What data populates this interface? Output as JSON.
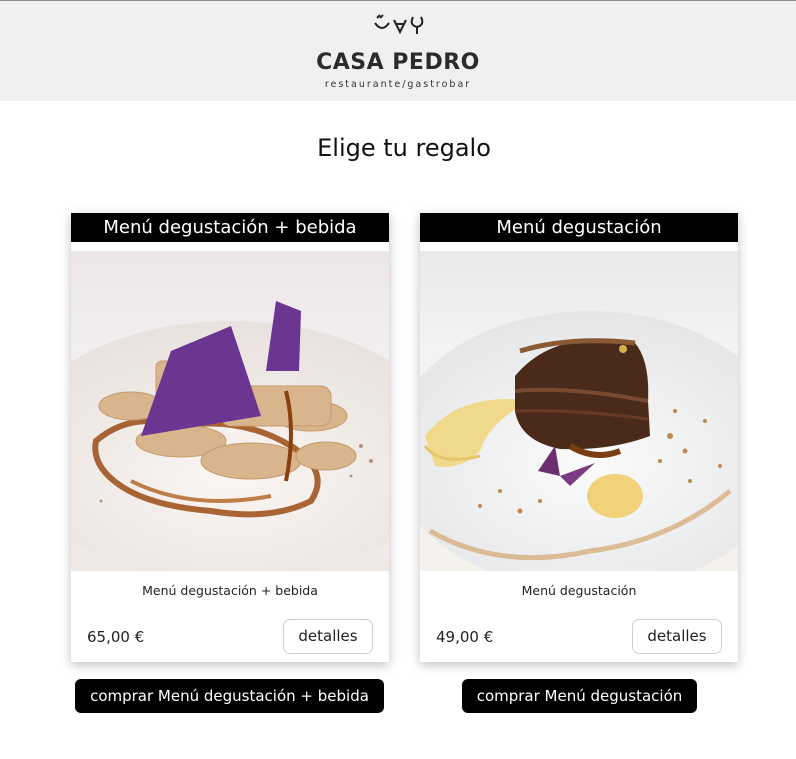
{
  "header": {
    "brand_name": "CASA PEDRO",
    "tagline": "restaurante/gastrobar",
    "logo_icons": [
      "cup-icon",
      "glass-icon",
      "wine-glass-icon"
    ]
  },
  "page": {
    "title": "Elige tu regalo"
  },
  "cards": [
    {
      "title": "Menú degustación + bebida",
      "name": "Menú degustación + bebida",
      "price": "65,00 €",
      "details_label": "detalles",
      "buy_label": "comprar Menú degustación + bebida"
    },
    {
      "title": "Menú degustación",
      "name": "Menú degustación",
      "price": "49,00 €",
      "details_label": "detalles",
      "buy_label": "comprar Menú degustación"
    }
  ],
  "colors": {
    "header_bg": "#f0f0f0",
    "card_head_bg": "#000000",
    "button_bg": "#000000"
  }
}
